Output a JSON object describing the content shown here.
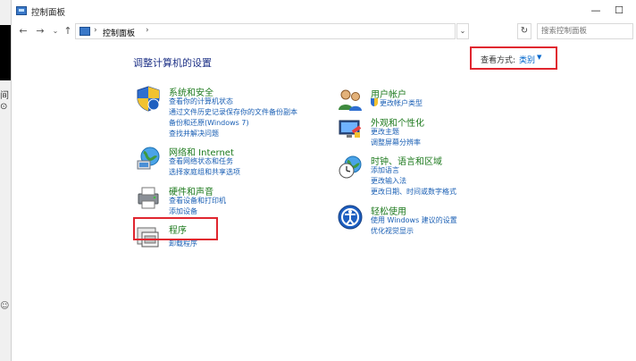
{
  "window": {
    "title": "控制面板",
    "min_glyph": "—",
    "max_glyph": "☐"
  },
  "addressbar": {
    "back": "←",
    "forward": "→",
    "dropdown": "⌄",
    "up": "↑",
    "separator": "›",
    "crumb": "控制面板",
    "refresh": "↻",
    "search_placeholder": "搜索控制面板"
  },
  "main": {
    "title": "调整计算机的设置",
    "view_by": {
      "label": "查看方式:",
      "value": "类别",
      "arrow": "▼"
    }
  },
  "categories_left": [
    {
      "title": "系统和安全",
      "links": [
        "查看你的计算机状态",
        "通过文件历史记录保存你的文件备份副本",
        "备份和还原(Windows 7)",
        "查找并解决问题"
      ]
    },
    {
      "title": "网络和 Internet",
      "links": [
        "查看网络状态和任务",
        "选择家庭组和共享选项"
      ]
    },
    {
      "title": "硬件和声音",
      "links": [
        "查看设备和打印机",
        "添加设备"
      ]
    },
    {
      "title": "程序",
      "links": [
        "卸载程序"
      ]
    }
  ],
  "categories_right": [
    {
      "title": "用户帐户",
      "links": [
        "更改帐户类型"
      ]
    },
    {
      "title": "外观和个性化",
      "links": [
        "更改主题",
        "调整屏幕分辨率"
      ]
    },
    {
      "title": "时钟、语言和区域",
      "links": [
        "添加语言",
        "更改输入法",
        "更改日期、时间或数字格式"
      ]
    },
    {
      "title": "轻松使用",
      "links": [
        "使用 Windows 建议的设置",
        "优化视觉显示"
      ]
    }
  ],
  "desktop": {
    "text1": "间",
    "text2": "⊙",
    "text3": "☺"
  },
  "colors": {
    "highlight": "#e0262f",
    "link": "#1a5fb4",
    "category": "#1e7a1e",
    "title": "#1e3287"
  }
}
